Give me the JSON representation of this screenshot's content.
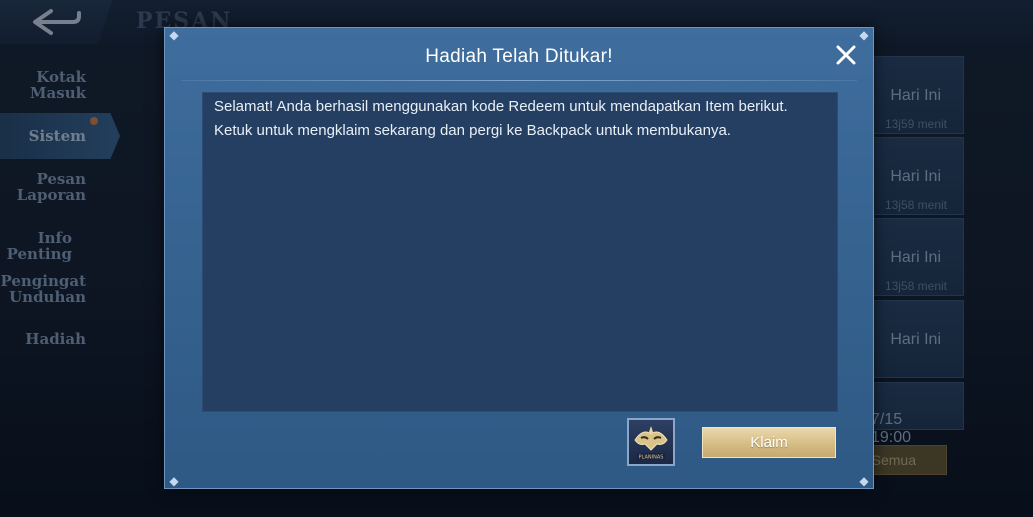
{
  "background": {
    "page_title": "PESAN",
    "sidebar": {
      "items": [
        {
          "label": "Kotak\nMasuk"
        },
        {
          "label": "Sistem"
        },
        {
          "label": "Pesan\nLaporan"
        },
        {
          "label": "Info Penting"
        },
        {
          "label": "Pengingat\nUnduhan"
        },
        {
          "label": "Hadiah"
        }
      ],
      "active": "Sistem"
    },
    "messages": [
      {
        "date": "Hari Ini",
        "time": "13j59 menit"
      },
      {
        "date": "Hari Ini",
        "time": "13j58 menit"
      },
      {
        "date": "Hari Ini",
        "time": "13j58 menit"
      },
      {
        "date": "Hari Ini",
        "time": ""
      },
      {
        "date": "7/15 19:00",
        "time": ""
      }
    ],
    "read_all_label": "Semua"
  },
  "dialog": {
    "title": "Hadiah Telah Ditukar!",
    "body": "Selamat! Anda berhasil menggunakan kode Redeem untuk mendapatkan Item berikut. Ketuk untuk mengklaim sekarang dan pergi ke Backpack untuk membukanya.",
    "claim_label": "Klaim",
    "item_caption": "PLANINAS"
  },
  "colors": {
    "dialog_bg": "#3a6796",
    "content_bg": "#243f62",
    "claim_button": "#d7bf88",
    "accent_dot": "#e0874b"
  },
  "icons": {
    "back": "back-arrow-icon",
    "close": "close-icon",
    "item": "mask-item-icon"
  }
}
